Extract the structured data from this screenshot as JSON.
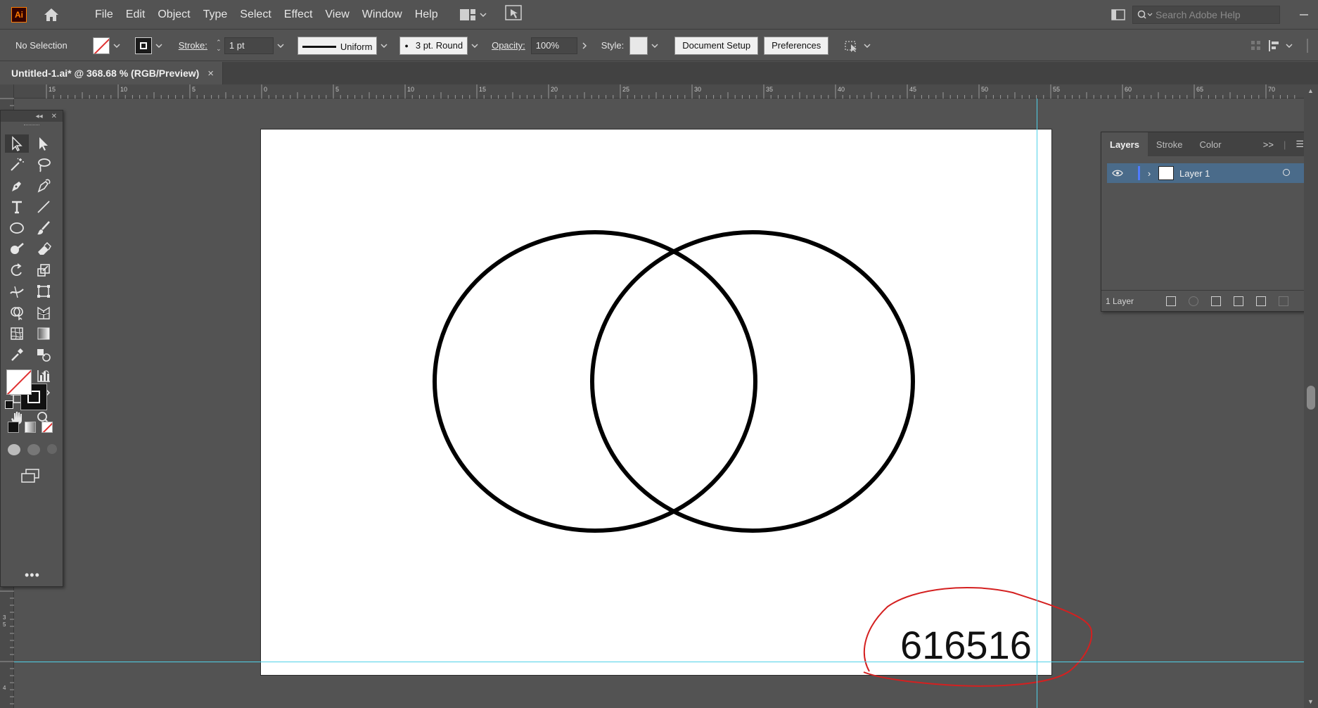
{
  "menubar": {
    "logo": "Ai",
    "items": [
      "File",
      "Edit",
      "Object",
      "Type",
      "Select",
      "Effect",
      "View",
      "Window",
      "Help"
    ],
    "search_placeholder": "Search Adobe Help"
  },
  "controlbar": {
    "selection_label": "No Selection",
    "stroke_label": "Stroke:",
    "stroke_weight": "1 pt",
    "profile": "Uniform",
    "brush": "3 pt. Round",
    "opacity_label": "Opacity:",
    "opacity_value": "100%",
    "style_label": "Style:",
    "document_setup": "Document Setup",
    "preferences": "Preferences"
  },
  "document_tab": {
    "title": "Untitled-1.ai* @ 368.68 % (RGB/Preview)",
    "close": "×"
  },
  "ruler": {
    "h_labels": [
      "15",
      "10",
      "5",
      "0",
      "5",
      "10",
      "15",
      "20",
      "25",
      "30",
      "35",
      "40",
      "45",
      "50",
      "55",
      "60",
      "65",
      "70"
    ],
    "v_labels": [
      "3",
      "5",
      "4"
    ]
  },
  "artwork": {
    "annotation_text": "616516",
    "annotation_color": "#d42020",
    "stroke_color": "#000000",
    "guide_color": "#4fd1e8"
  },
  "layers_panel": {
    "tabs": [
      "Layers",
      "Stroke",
      "Color"
    ],
    "active_tab": "Layers",
    "layer_name": "Layer 1",
    "layer_count": "1 Layer",
    "selection_color": "#4a6b8a"
  }
}
